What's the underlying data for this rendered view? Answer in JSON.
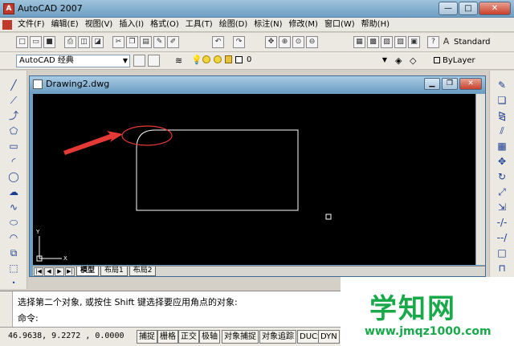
{
  "window": {
    "title": "AutoCAD 2007",
    "min": "—",
    "max": "□",
    "close": "✕"
  },
  "menus": [
    "文件(F)",
    "编辑(E)",
    "视图(V)",
    "插入(I)",
    "格式(O)",
    "工具(T)",
    "绘图(D)",
    "标注(N)",
    "修改(M)",
    "窗口(W)",
    "帮助(H)"
  ],
  "toolbar": {
    "text_style": "Standard"
  },
  "workspace": {
    "value": "AutoCAD 经典"
  },
  "layer": {
    "value": "0"
  },
  "color": {
    "value": "ByLayer"
  },
  "drawing": {
    "title": "Drawing2.dwg"
  },
  "tabs": [
    "模型",
    "布局1",
    "布局2"
  ],
  "ucs": {
    "x": "X",
    "y": "Y"
  },
  "command": {
    "prompt1": "选择第二个对象, 或按住 Shift 键选择要应用角点的对象:",
    "prompt2": "命令:"
  },
  "status": {
    "coords": "46.9638, 9.2272 , 0.0000",
    "buttons": [
      "捕捉",
      "栅格",
      "正交",
      "极轴",
      "对象捕捉",
      "对象追踪",
      "DUCS",
      "DYN"
    ]
  },
  "watermark": {
    "line1": "学知网",
    "line2": "www.jmqz1000.com"
  },
  "colors": {
    "canvas": "#000000",
    "annotation": "#e53935",
    "watermark": "#19a84a"
  }
}
